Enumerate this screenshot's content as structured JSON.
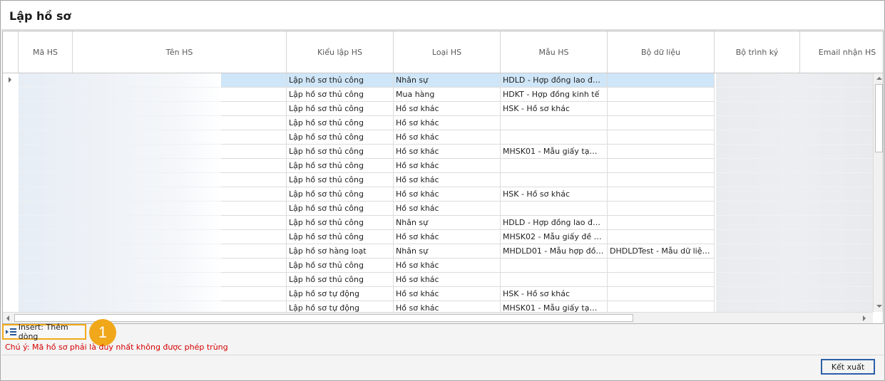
{
  "window": {
    "title": "Lập hồ sơ"
  },
  "grid": {
    "columns": [
      "Mã HS",
      "Tên HS",
      "Kiểu lập HS",
      "Loại HS",
      "Mẫu HS",
      "Bộ dữ liệu",
      "Bộ trình ký",
      "Email nhận HS"
    ],
    "rows": [
      {
        "kieu": "Lập hồ sơ thủ công",
        "loai": "Nhân sự",
        "mau": "HDLD - Hợp đồng lao động",
        "bdl": ""
      },
      {
        "kieu": "Lập hồ sơ thủ công",
        "loai": "Mua hàng",
        "mau": "HDKT - Hợp đồng kinh tế",
        "bdl": ""
      },
      {
        "kieu": "Lập hồ sơ thủ công",
        "loai": "Hồ sơ khác",
        "mau": "HSK - Hồ sơ khác",
        "bdl": ""
      },
      {
        "kieu": "Lập hồ sơ thủ công",
        "loai": "Hồ sơ khác",
        "mau": "",
        "bdl": ""
      },
      {
        "kieu": "Lập hồ sơ thủ công",
        "loai": "Hồ sơ khác",
        "mau": "",
        "bdl": ""
      },
      {
        "kieu": "Lập hồ sơ thủ công",
        "loai": "Hồ sơ khác",
        "mau": "MHSK01 - Mẫu giấy tạm ứn...",
        "bdl": ""
      },
      {
        "kieu": "Lập hồ sơ thủ công",
        "loai": "Hồ sơ khác",
        "mau": "",
        "bdl": ""
      },
      {
        "kieu": "Lập hồ sơ thủ công",
        "loai": "Hồ sơ khác",
        "mau": "",
        "bdl": ""
      },
      {
        "kieu": "Lập hồ sơ thủ công",
        "loai": "Hồ sơ khác",
        "mau": "HSK - Hồ sơ khác",
        "bdl": ""
      },
      {
        "kieu": "Lập hồ sơ thủ công",
        "loai": "Hồ sơ khác",
        "mau": "",
        "bdl": ""
      },
      {
        "kieu": "Lập hồ sơ thủ công",
        "loai": "Nhân sự",
        "mau": "HDLD - Hợp đồng lao động",
        "bdl": ""
      },
      {
        "kieu": "Lập hồ sơ thủ công",
        "loai": "Hồ sơ khác",
        "mau": "MHSK02 - Mẫu giấy đề nghị...",
        "bdl": ""
      },
      {
        "kieu": "Lập hồ sơ hàng loạt",
        "loai": "Nhân sự",
        "mau": "MHDLD01 - Mẫu hợp đồng l...",
        "bdl": "DHDLDTest - Mẫu dữ liệu H..."
      },
      {
        "kieu": "Lập hồ sơ thủ công",
        "loai": "Hồ sơ khác",
        "mau": "",
        "bdl": ""
      },
      {
        "kieu": "Lập hồ sơ thủ công",
        "loai": "Hồ sơ khác",
        "mau": "",
        "bdl": ""
      },
      {
        "kieu": "Lập hồ sơ tự động",
        "loai": "Hồ sơ khác",
        "mau": "HSK - Hồ sơ khác",
        "bdl": ""
      },
      {
        "kieu": "Lập hồ sơ tự động",
        "loai": "Hồ sơ khác",
        "mau": "MHSK01 - Mẫu giấy tạm ứn...",
        "bdl": ""
      }
    ]
  },
  "toolbar": {
    "insert_label": "Insert: Thêm dòng",
    "badge_number": "1"
  },
  "note": "Chú ý: Mã hồ sơ phải là duy nhất không được phép trùng",
  "footer": {
    "export_label": "Kết xuất"
  },
  "colors": {
    "selected_row": "#cfe6f8",
    "highlight": "#f1a91b",
    "note_text": "#d60000",
    "primary_border": "#2c5fa8"
  }
}
